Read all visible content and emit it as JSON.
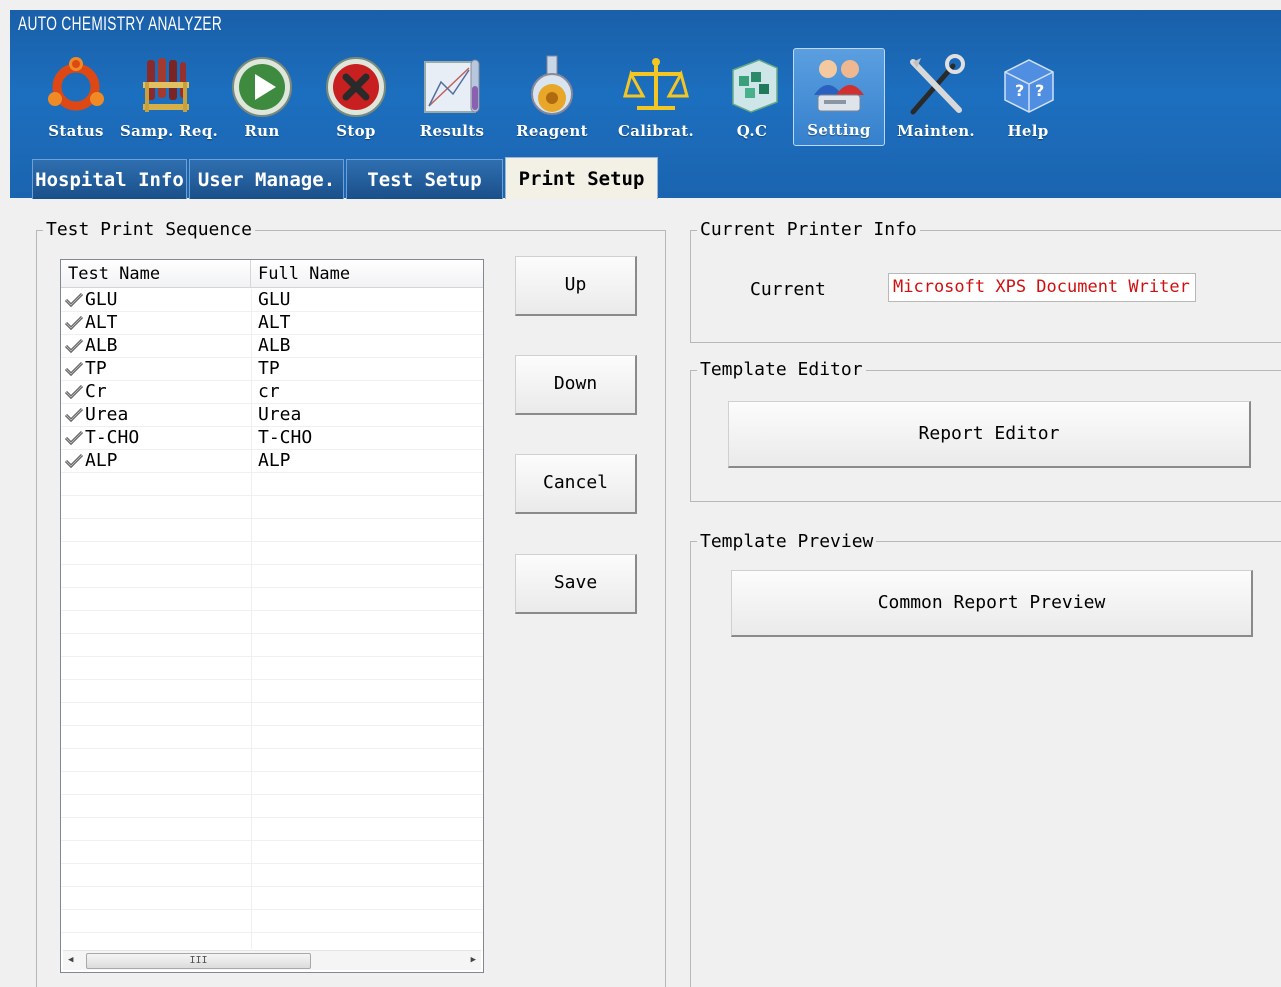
{
  "app": {
    "title": "AUTO CHEMISTRY ANALYZER"
  },
  "toolbar": [
    {
      "label": "Status",
      "icon": "ubuntu-ring-icon"
    },
    {
      "label": "Samp. Req.",
      "icon": "test-tube-rack-icon"
    },
    {
      "label": "Run",
      "icon": "play-icon"
    },
    {
      "label": "Stop",
      "icon": "stop-icon"
    },
    {
      "label": "Results",
      "icon": "results-chart-icon"
    },
    {
      "label": "Reagent",
      "icon": "flask-icon"
    },
    {
      "label": "Calibrat.",
      "icon": "balance-scale-icon"
    },
    {
      "label": "Q.C",
      "icon": "qc-cube-icon"
    },
    {
      "label": "Setting",
      "icon": "users-setting-icon"
    },
    {
      "label": "Mainten.",
      "icon": "tools-icon"
    },
    {
      "label": "Help",
      "icon": "help-cube-icon"
    }
  ],
  "tabs": [
    {
      "label": "Hospital Info"
    },
    {
      "label": "User Manage."
    },
    {
      "label": "Test Setup"
    },
    {
      "label": "Print Setup"
    }
  ],
  "left": {
    "legend": "Test Print Sequence",
    "columns": [
      "Test Name",
      "Full Name"
    ],
    "rows": [
      {
        "name": "GLU",
        "full": "GLU"
      },
      {
        "name": "ALT",
        "full": "ALT"
      },
      {
        "name": "ALB",
        "full": "ALB"
      },
      {
        "name": "TP",
        "full": "TP"
      },
      {
        "name": "Cr",
        "full": "cr"
      },
      {
        "name": "Urea",
        "full": "Urea"
      },
      {
        "name": "T-CHO",
        "full": "T-CHO"
      },
      {
        "name": "ALP",
        "full": "ALP"
      }
    ],
    "scroll_thumb": "III",
    "buttons": {
      "up": "Up",
      "down": "Down",
      "cancel": "Cancel",
      "save": "Save"
    }
  },
  "printer": {
    "legend": "Current Printer Info",
    "label": "Current",
    "value": "Microsoft XPS Document Writer"
  },
  "template_editor": {
    "legend": "Template Editor",
    "button": "Report Editor"
  },
  "template_preview": {
    "legend": "Template Preview",
    "button": "Common Report Preview"
  },
  "colors": {
    "header_blue": "#1c6fbf",
    "printer_text": "#d01010",
    "active_tab": "#f3f1e6"
  }
}
